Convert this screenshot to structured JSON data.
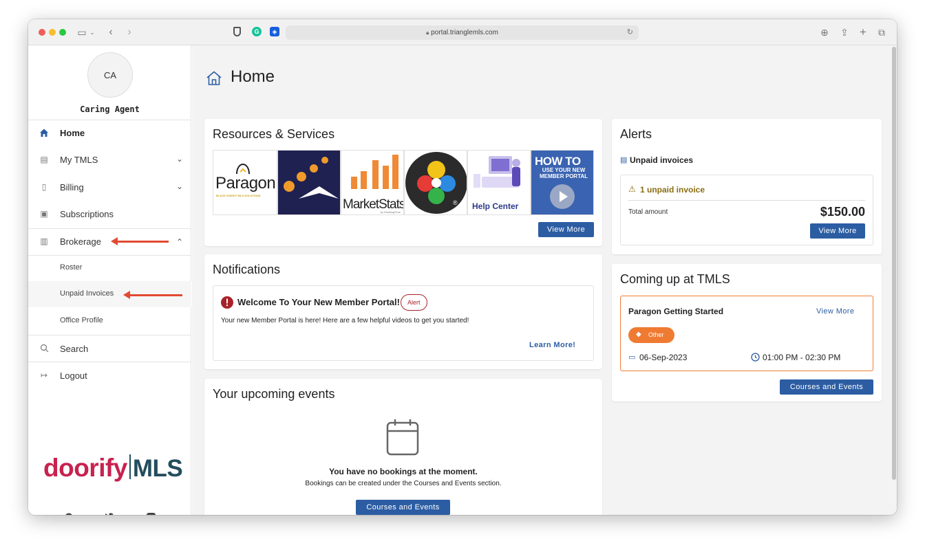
{
  "browser": {
    "url": "portal.trianglemls.com"
  },
  "sidebar": {
    "avatar_initials": "CA",
    "user_name": "Caring Agent",
    "nav": [
      {
        "label": "Home",
        "icon": "home-icon"
      },
      {
        "label": "My TMLS",
        "icon": "card-icon"
      },
      {
        "label": "Billing",
        "icon": "document-icon"
      },
      {
        "label": "Subscriptions",
        "icon": "calendar-icon"
      },
      {
        "label": "Brokerage",
        "icon": "building-icon"
      }
    ],
    "brokerage_sub": [
      "Roster",
      "Unpaid Invoices",
      "Office Profile"
    ],
    "bottom_nav": [
      {
        "label": "Search",
        "icon": "search-icon"
      },
      {
        "label": "Logout",
        "icon": "logout-icon"
      }
    ],
    "brand": {
      "part1": "doorify",
      "part2": "MLS"
    }
  },
  "main": {
    "title": "Home",
    "resources": {
      "title": "Resources & Services",
      "tiles": [
        {
          "name": "Paragon",
          "text": "Paragon",
          "sub": "BLACK KNIGHT MLS SOLUTIONS"
        },
        {
          "name": "Navigation",
          "text": ""
        },
        {
          "name": "MarketStats",
          "text": "MarketStats",
          "sub": "by ShowingTime"
        },
        {
          "name": "Colorful app",
          "text": "®"
        },
        {
          "name": "Help Center",
          "text": "Help Center"
        },
        {
          "name": "How to use your new member portal",
          "text": "HOW TO",
          "sub": "USE YOUR NEW MEMBER PORTAL"
        }
      ],
      "view_more": "View More"
    },
    "notifications": {
      "title": "Notifications",
      "item_title": "Welcome To Your New Member Portal!",
      "badge": "Alert",
      "body": "Your new Member Portal is here! Here are a few helpful videos to get you started!",
      "link": "Learn More!"
    },
    "events": {
      "title": "Your upcoming events",
      "empty_title": "You have no bookings at the moment.",
      "empty_sub": "Bookings can be created under the Courses and Events section.",
      "button": "Courses and Events"
    },
    "alerts": {
      "title": "Alerts",
      "section": "Unpaid invoices",
      "warning": "1 unpaid invoice",
      "total_label": "Total amount",
      "total_value": "$150.00",
      "button": "View More"
    },
    "coming_up": {
      "title": "Coming up at TMLS",
      "event_title": "Paragon Getting Started",
      "view_more": "View More",
      "tag": "Other",
      "date": "06-Sep-2023",
      "time": "01:00 PM - 02:30 PM",
      "button": "Courses and Events"
    }
  },
  "colors": {
    "primary": "#2c5da3",
    "alert_red": "#a8222a",
    "tag_orange": "#ef7b32",
    "warning_olive": "#8a6d12",
    "annotation_arrow": "#e24a32"
  }
}
